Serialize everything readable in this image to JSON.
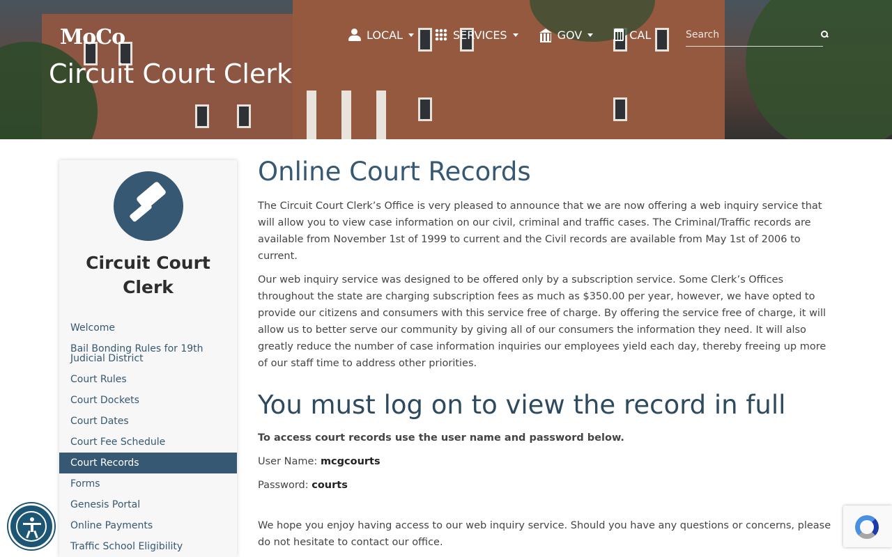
{
  "header": {
    "logo_text": "MoCo",
    "site_title": "Circuit Court Clerk",
    "nav": [
      {
        "label": "LOCAL",
        "icon": "user-icon",
        "dropdown": true
      },
      {
        "label": "SERVICES",
        "icon": "grid-icon",
        "dropdown": true
      },
      {
        "label": "GOV",
        "icon": "government-building-icon",
        "dropdown": true
      },
      {
        "label": "CAL",
        "icon": "calendar-icon",
        "dropdown": false
      }
    ],
    "search": {
      "placeholder": "Search",
      "value": ""
    }
  },
  "sidebar": {
    "icon": "gavel-icon",
    "title": "Circuit Court Clerk",
    "items": [
      {
        "label": "Welcome",
        "active": false
      },
      {
        "label": "Bail Bonding Rules for 19th Judicial District",
        "active": false
      },
      {
        "label": "Court Rules",
        "active": false
      },
      {
        "label": "Court Dockets",
        "active": false
      },
      {
        "label": "Court Dates",
        "active": false
      },
      {
        "label": "Court Fee Schedule",
        "active": false
      },
      {
        "label": "Court Records",
        "active": true
      },
      {
        "label": "Forms",
        "active": false
      },
      {
        "label": "Genesis Portal",
        "active": false
      },
      {
        "label": "Online Payments",
        "active": false
      },
      {
        "label": "Traffic School Eligibility",
        "active": false
      }
    ]
  },
  "main": {
    "heading": "Online Court Records",
    "paragraph1": "The Circuit Court Clerk’s Office is very pleased to announce that we are now offering a web inquiry service that will allow you to view case information on our civil, criminal and traffic cases. The Criminal/Traffic records are available from November 1st of 1999 to current and the Civil records are available from May 1st of 2006 to current.",
    "paragraph2": "Our web inquiry service was designed to be offered only by a subscription service. Some Clerk’s Offices throughout the state are charging subscription fees as much as $350.00 per year, however, we have opted to provide our citizens and consumers with this service free of charge. By offering the service free of charge, it will allow us to better serve our community by giving all of our consumers the information they need. It will also greatly reduce the number of case information inquiries our employees yield each day, thereby freeing up more of our staff time to address other priorities.",
    "subheading": "You must log on to view the record in full",
    "access_note": "To access court records use the user name and password below.",
    "username_label": "User Name:",
    "username_value": "mcgcourts",
    "password_label": "Password:",
    "password_value": "courts",
    "closing": "We hope you enjoy having access to our web inquiry service. Should you have any questions or concerns, please do not hesitate to contact our office."
  },
  "widgets": {
    "accessibility_icon": "accessibility-icon",
    "recaptcha_icon": "recaptcha-icon"
  },
  "colors": {
    "primary": "#365872",
    "text": "#444444",
    "sidebar_bg": "#f7f7f7"
  }
}
